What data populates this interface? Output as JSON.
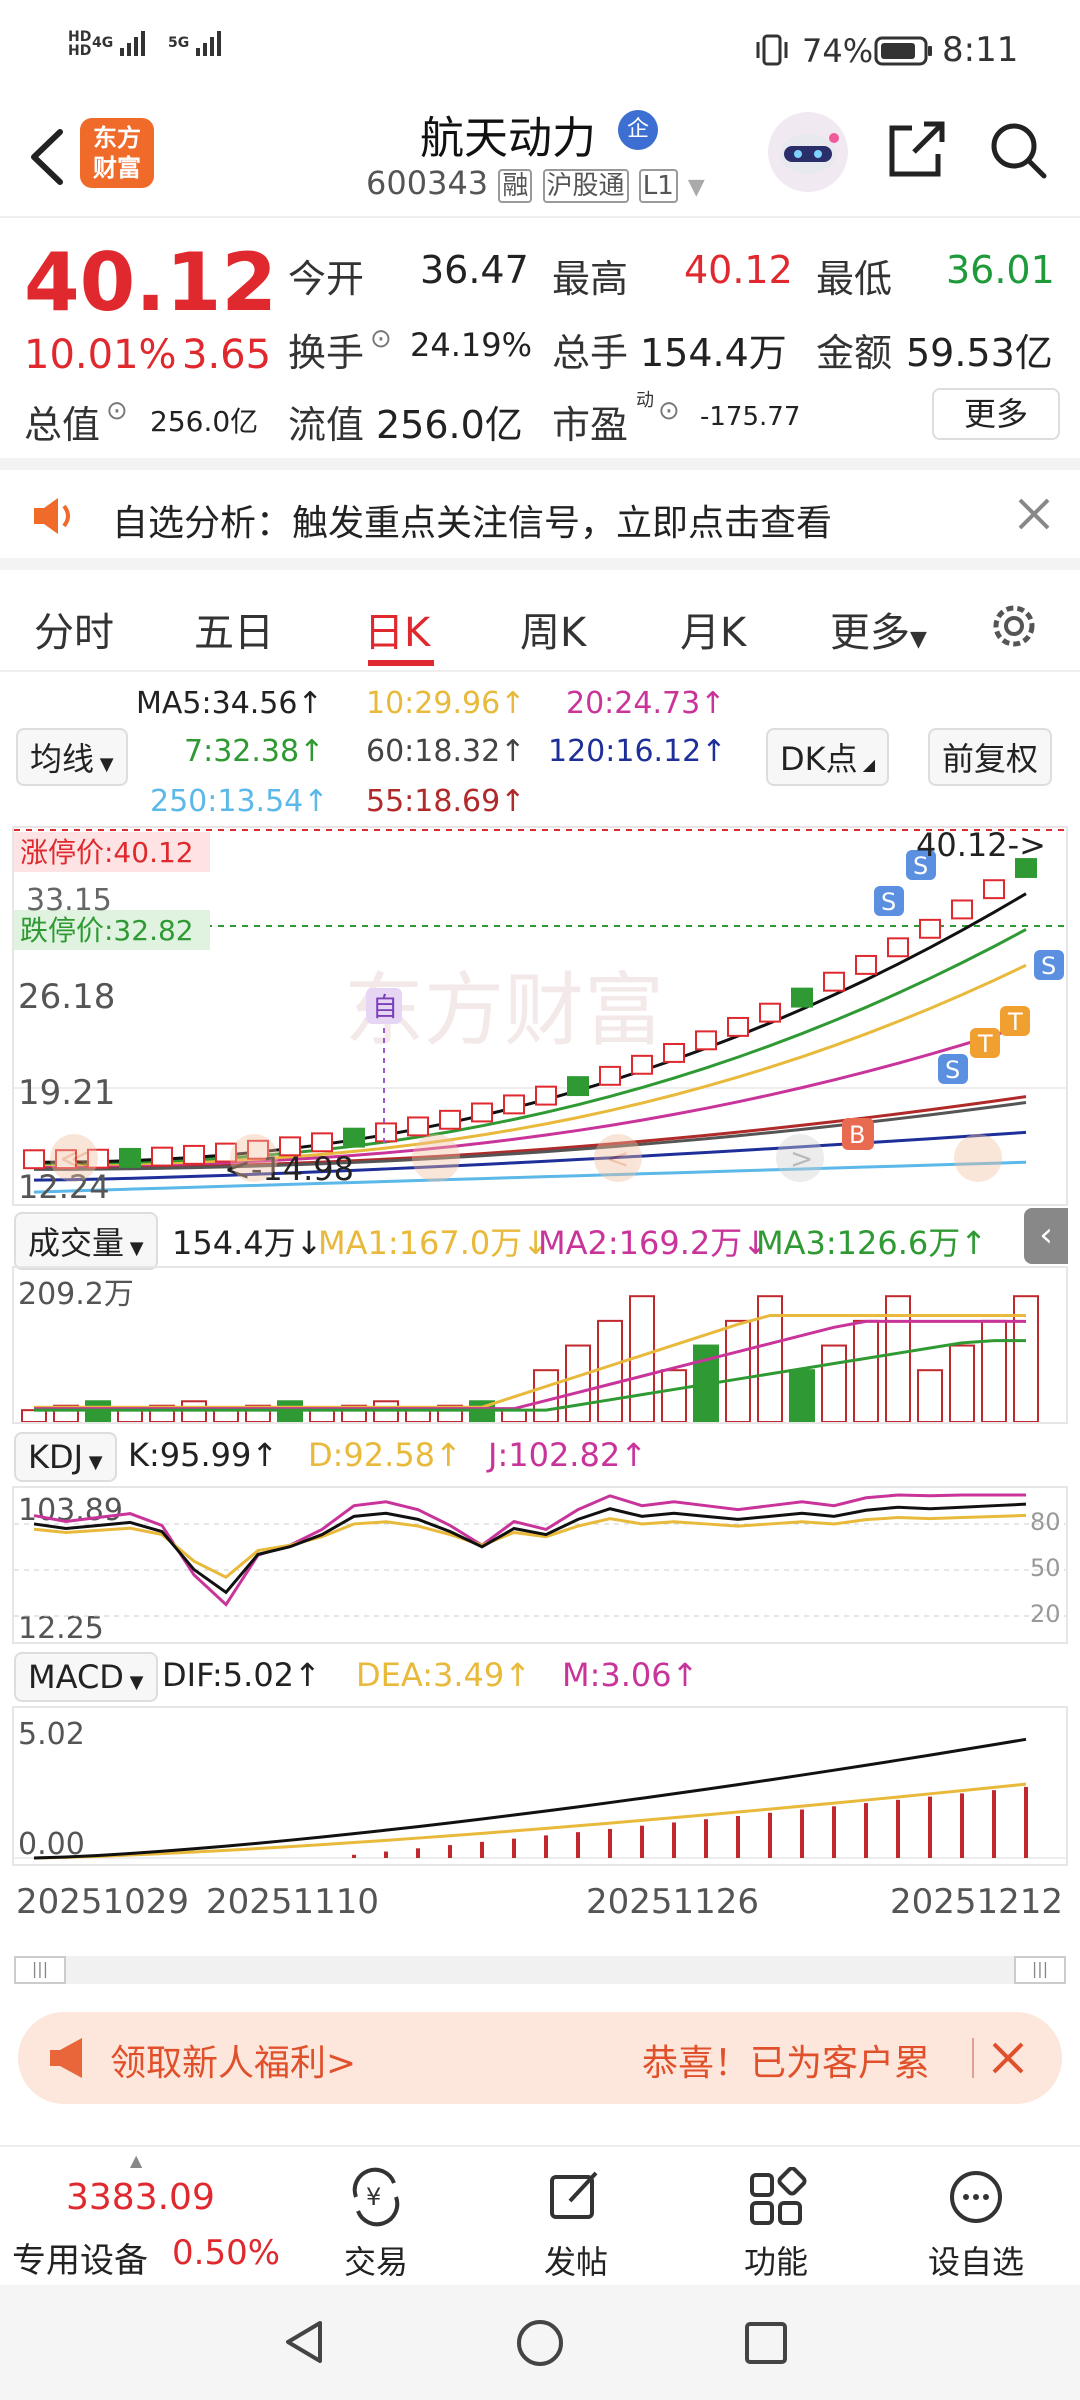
{
  "status": {
    "signal1": "4G",
    "signal2": "5G",
    "battery": "74%",
    "time": "8:11"
  },
  "header": {
    "logo_text": "东方\n财富",
    "name": "航天动力",
    "badge": "企",
    "code": "600343",
    "tags": [
      "融",
      "沪股通",
      "L1"
    ]
  },
  "quote": {
    "price": "40.12",
    "change_pct": "10.01%",
    "change": "3.65",
    "open_label": "今开",
    "open": "36.47",
    "high_label": "最高",
    "high": "40.12",
    "low_label": "最低",
    "low": "36.01",
    "turnover_label": "换手",
    "turnover": "24.19%",
    "volume_label": "总手",
    "volume": "154.4万",
    "amount_label": "金额",
    "amount": "59.53亿",
    "mcap_label": "总值",
    "mcap": "256.0亿",
    "float_label": "流值",
    "float": "256.0亿",
    "pe_label": "市盈",
    "pe_sup": "动",
    "pe": "-175.77",
    "more": "更多"
  },
  "notice": {
    "text": "自选分析：触发重点关注信号，立即点击查看"
  },
  "tabs": [
    "分时",
    "五日",
    "日K",
    "周K",
    "月K",
    "更多"
  ],
  "active_tab": "日K",
  "ma": {
    "selector": "均线",
    "ma5": "MA5:34.56↑",
    "ma10": "10:29.96↑",
    "ma20": "20:24.73↑",
    "ma7": "7:32.38↑",
    "ma60": "60:18.32↑",
    "ma120": "120:16.12↑",
    "ma250": "250:13.54↑",
    "ma55": "55:18.69↑",
    "dk_button": "DK点",
    "adjust_button": "前复权",
    "colors": {
      "ma5": "#222222",
      "ma10": "#e8b93a",
      "ma20": "#c9349a",
      "ma7": "#2f9a33",
      "ma60": "#444444",
      "ma120": "#1f2f9a",
      "ma250": "#5bb8e8",
      "ma55": "#b02a2a"
    }
  },
  "kline": {
    "limit_up": "涨停价:40.12",
    "limit_down": "跌停价:32.82",
    "y_labels": [
      "40.12",
      "33.15",
      "26.18",
      "19.21",
      "12.24"
    ],
    "last_label": "40.12->",
    "min_label": "<-14.98",
    "watermark": "东方财富",
    "tag_zi": "自"
  },
  "volume": {
    "selector": "成交量",
    "value": "154.4万↓",
    "ma1": "MA1:167.0万↓",
    "ma2": "MA2:169.2万↓",
    "ma3": "MA3:126.6万↑",
    "y_top": "209.2万"
  },
  "kdj": {
    "selector": "KDJ",
    "k": "K:95.99↑",
    "d": "D:92.58↑",
    "j": "J:102.82↑",
    "y_top": "103.89",
    "y_bottom": "12.25",
    "levels": [
      "80",
      "50",
      "20"
    ]
  },
  "macd": {
    "selector": "MACD",
    "dif": "DIF:5.02↑",
    "dea": "DEA:3.49↑",
    "m": "M:3.06↑",
    "y_top": "5.02",
    "y_zero": "0.00"
  },
  "dates": [
    "20251029",
    "20251110",
    "20251126",
    "20251212"
  ],
  "promo": {
    "left": "领取新人福利>",
    "right": "恭喜！已为客户累"
  },
  "bottom": {
    "index_value": "3383.09",
    "index_name": "专用设备",
    "index_change": "0.50%",
    "items": [
      "交易",
      "发帖",
      "功能",
      "设自选"
    ]
  }
}
